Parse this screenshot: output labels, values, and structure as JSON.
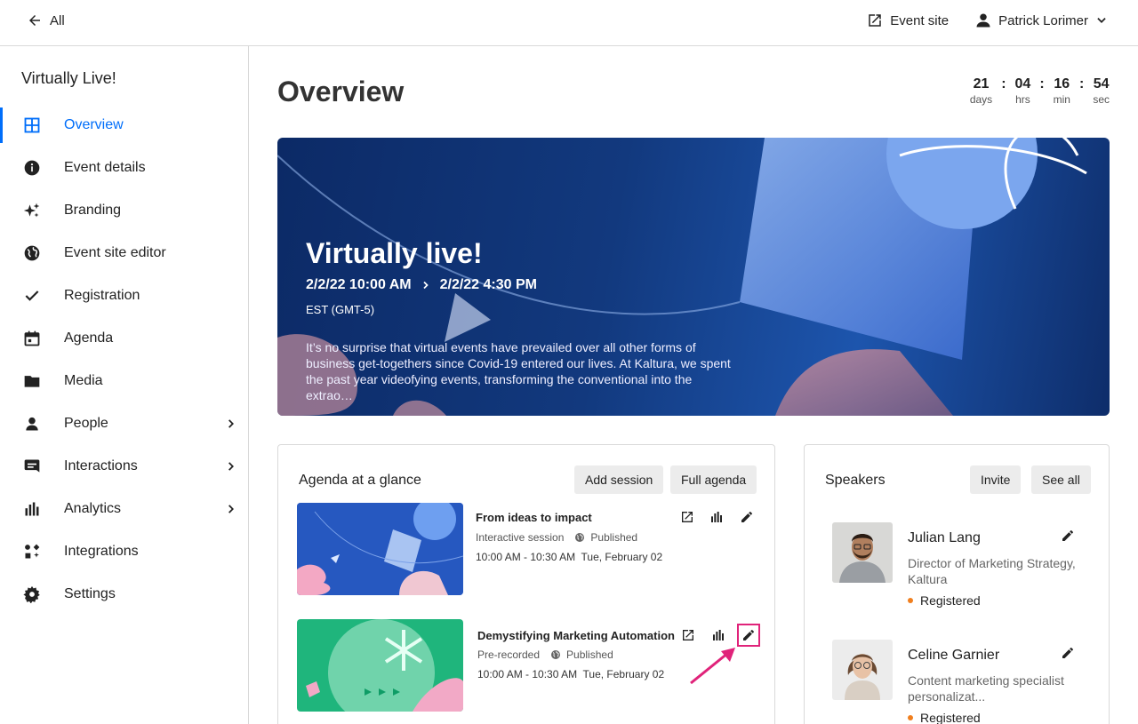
{
  "topbar": {
    "back_label": "All",
    "event_site_label": "Event site",
    "user_name": "Patrick Lorimer"
  },
  "sidebar": {
    "title": "Virtually Live!",
    "items": [
      {
        "label": "Overview",
        "icon": "grid-icon"
      },
      {
        "label": "Event details",
        "icon": "info-icon"
      },
      {
        "label": "Branding",
        "icon": "sparkle-icon"
      },
      {
        "label": "Event site editor",
        "icon": "globe-icon"
      },
      {
        "label": "Registration",
        "icon": "check-icon"
      },
      {
        "label": "Agenda",
        "icon": "calendar-icon"
      },
      {
        "label": "Media",
        "icon": "folder-icon"
      },
      {
        "label": "People",
        "icon": "person-icon"
      },
      {
        "label": "Interactions",
        "icon": "chat-icon"
      },
      {
        "label": "Analytics",
        "icon": "bar-chart-icon"
      },
      {
        "label": "Integrations",
        "icon": "integrations-icon"
      },
      {
        "label": "Settings",
        "icon": "gear-icon"
      }
    ]
  },
  "main": {
    "title": "Overview",
    "countdown": {
      "days": "21",
      "days_label": "days",
      "hrs": "04",
      "hrs_label": "hrs",
      "min": "16",
      "min_label": "min",
      "sec": "54",
      "sec_label": "sec"
    },
    "hero": {
      "title": "Virtually live!",
      "start": "2/2/22 10:00 AM",
      "end": "2/2/22 4:30 PM",
      "timezone": "EST (GMT-5)",
      "description": "It’s no surprise that virtual events have prevailed over all other forms of business get-togethers since Covid-19 entered our lives. At Kaltura, we spent the past year videofying events, transforming the conventional into the extrao…"
    },
    "agenda": {
      "title": "Agenda at a glance",
      "add_session": "Add session",
      "full_agenda": "Full agenda",
      "sessions": [
        {
          "title": "From ideas to impact",
          "type": "Interactive session",
          "status": "Published",
          "time": "10:00 AM - 10:30 AM",
          "date": "Tue, February 02"
        },
        {
          "title": "Demystifying Marketing Automation",
          "type": "Pre-recorded",
          "status": "Published",
          "time": "10:00 AM - 10:30 AM",
          "date": "Tue, February 02"
        }
      ]
    },
    "speakers": {
      "title": "Speakers",
      "invite": "Invite",
      "see_all": "See all",
      "list": [
        {
          "name": "Julian Lang",
          "role": "Director of Marketing Strategy, Kaltura",
          "status": "Registered"
        },
        {
          "name": "Celine Garnier",
          "role": "Content marketing specialist personalizat...",
          "status": "Registered"
        }
      ]
    }
  },
  "colors": {
    "accent": "#006efa",
    "highlight": "#e0237a",
    "status_dot": "#f07f1e"
  }
}
